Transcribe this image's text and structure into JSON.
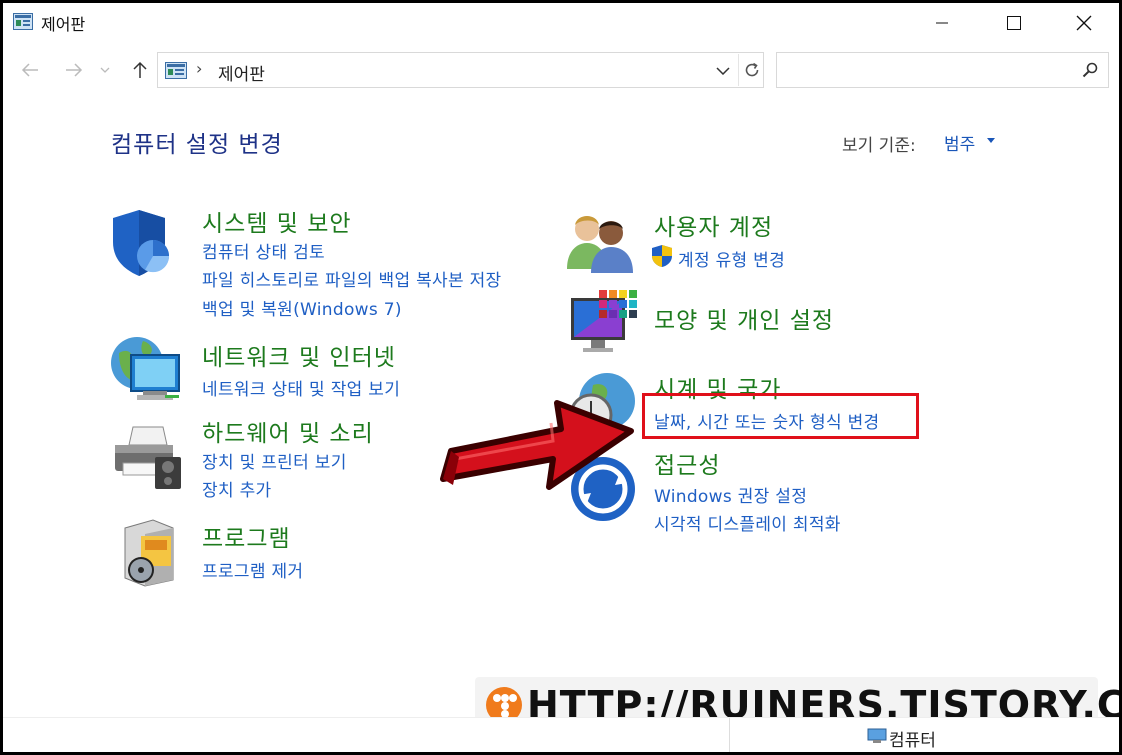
{
  "window": {
    "title": "제어판",
    "icon": "control-panel-icon"
  },
  "nav": {
    "back_icon": "back-arrow-icon",
    "forward_icon": "forward-arrow-icon",
    "recent_icon": "chevron-down-icon",
    "up_icon": "up-arrow-icon",
    "address_separator": "›",
    "address_text": "제어판",
    "search_placeholder": ""
  },
  "header": {
    "title": "컴퓨터 설정 변경",
    "view_by_label": "보기 기준:",
    "view_by_value": "범주"
  },
  "categories": [
    {
      "title": "시스템 및 보안",
      "icon": "shield-icon",
      "links": [
        "컴퓨터 상태 검토",
        "파일 히스토리로 파일의 백업 복사본 저장",
        "백업 및 복원(Windows 7)"
      ]
    },
    {
      "title": "네트워크 및 인터넷",
      "icon": "network-globe-icon",
      "links": [
        "네트워크 상태 및 작업 보기"
      ]
    },
    {
      "title": "하드웨어 및 소리",
      "icon": "printer-icon",
      "links": [
        "장치 및 프린터 보기",
        "장치 추가"
      ]
    },
    {
      "title": "프로그램",
      "icon": "program-box-icon",
      "links": [
        "프로그램 제거"
      ]
    },
    {
      "title": "사용자 계정",
      "icon": "users-icon",
      "links": [
        "계정 유형 변경"
      ]
    },
    {
      "title": "모양 및 개인 설정",
      "icon": "monitor-palette-icon",
      "links": []
    },
    {
      "title": "시계 및 국가",
      "icon": "clock-globe-icon",
      "links": [
        "날짜, 시간 또는 숫자 형식 변경"
      ]
    },
    {
      "title": "접근성",
      "icon": "accessibility-icon",
      "links": [
        "Windows 권장 설정",
        "시각적 디스플레이 최적화"
      ]
    }
  ],
  "watermark": {
    "text": "HTTP://RUINERS.TISTORY.COM"
  },
  "status": {
    "text": "컴퓨터"
  },
  "colors": {
    "title_blue": "#1e3287",
    "category_green": "#1d7a1d",
    "link_blue": "#1f5fc4",
    "highlight_red": "#e0101a",
    "arrow_red": "#d4101c"
  }
}
